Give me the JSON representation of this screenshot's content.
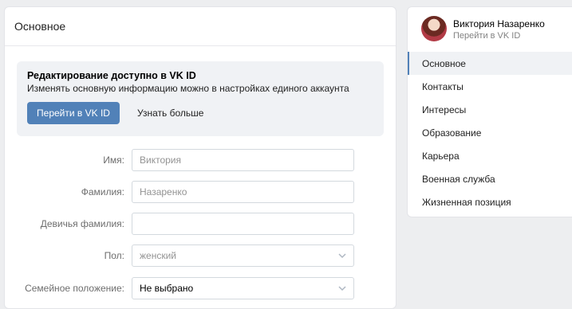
{
  "main": {
    "header_title": "Основное",
    "info_box": {
      "title": "Редактирование доступно в VK ID",
      "text": "Изменять основную информацию можно в настройках единого аккаунта",
      "primary_button": "Перейти в VK ID",
      "secondary_link": "Узнать больше"
    },
    "form": {
      "first_name": {
        "label": "Имя:",
        "value": "Виктория"
      },
      "last_name": {
        "label": "Фамилия:",
        "value": "Назаренко"
      },
      "maiden_name": {
        "label": "Девичья фамилия:",
        "value": ""
      },
      "gender": {
        "label": "Пол:",
        "value": "женский"
      },
      "marital_status": {
        "label": "Семейное положение:",
        "value": "Не выбрано"
      }
    }
  },
  "sidebar": {
    "profile_name": "Виктория Назаренко",
    "profile_link": "Перейти в VK ID",
    "items": [
      {
        "label": "Основное",
        "active": true
      },
      {
        "label": "Контакты",
        "active": false
      },
      {
        "label": "Интересы",
        "active": false
      },
      {
        "label": "Образование",
        "active": false
      },
      {
        "label": "Карьера",
        "active": false
      },
      {
        "label": "Военная служба",
        "active": false
      },
      {
        "label": "Жизненная позиция",
        "active": false
      }
    ]
  },
  "colors": {
    "accent": "#5181b8",
    "background": "#edeef0",
    "info_box": "#f0f2f5"
  },
  "icons": [
    "chevron-down-icon"
  ]
}
